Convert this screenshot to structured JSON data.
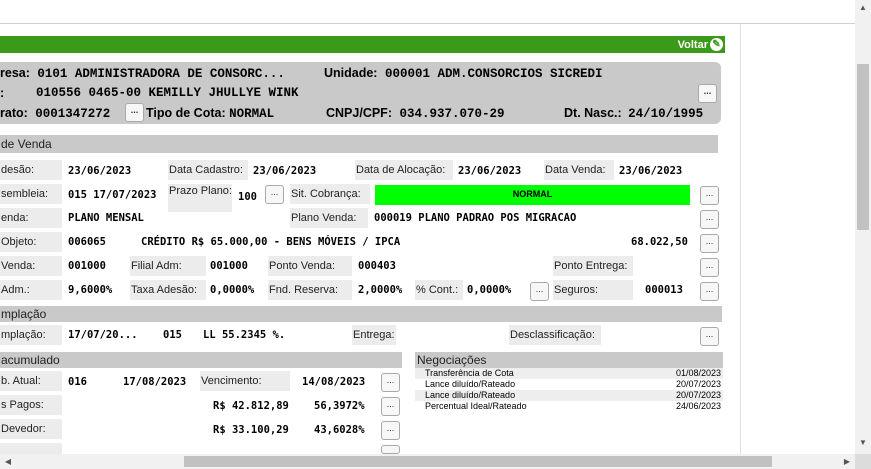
{
  "header": {
    "voltar": "Voltar",
    "empresa_label": "resa:",
    "empresa_value": "0101 ADMINISTRADORA DE CONSORC...",
    "unidade_label": "Unidade:",
    "unidade_value": "000001 ADM.CONSORCIOS SICREDI",
    "row2_label": ":",
    "cliente_value": "010556 0465-00 KEMILLY JHULLYE WINK",
    "contrato_label": "rato:",
    "contrato_value": "0001347272",
    "tipo_cota_label": "Tipo de Cota:",
    "tipo_cota_value": "NORMAL",
    "cnpj_label": "CNPJ/CPF:",
    "cnpj_value": "034.937.070-29",
    "nasc_label": "Dt. Nasc.:",
    "nasc_value": "24/10/1995"
  },
  "sections": {
    "venda": "de Venda",
    "contemplacao": "mplação",
    "acumulado": "acumulado"
  },
  "venda": {
    "adesao_label": "desão:",
    "adesao_value": "23/06/2023",
    "cadastro_label": "Data Cadastro:",
    "cadastro_value": "23/06/2023",
    "alocacao_label": "Data de Alocação:",
    "alocacao_value": "23/06/2023",
    "datavenda_label": "Data Venda:",
    "datavenda_value": "23/06/2023",
    "assembleia_label": "sembleia:",
    "assembleia_value": "015 17/07/2023",
    "prazo_label": "Prazo Plano:",
    "prazo_value": "100",
    "sitcob_label": "Sit. Cobrança:",
    "sitcob_value": "NORMAL",
    "planovenda_label_left": "enda:",
    "plano_value": "PLANO MENSAL",
    "planovenda_label": "Plano Venda:",
    "planovenda_value": "000019 PLANO PADRAO POS MIGRACAO",
    "objeto_label": "Objeto:",
    "objeto_code": "006065",
    "objeto_desc": "CRÉDITO R$ 65.000,00 - BENS MÓVEIS / IPCA",
    "objeto_valor": "68.022,50",
    "pvenda_label": "Venda:",
    "pvenda_value": "001000",
    "filial_label": "Filial Adm:",
    "filial_value": "001000",
    "pontovenda_label": "Ponto Venda:",
    "pontovenda_value": "000403",
    "entrega_label": "Ponto Entrega:",
    "adm_label": "Adm.:",
    "adm_value": "9,6000%",
    "taxa_label": "Taxa Adesão:",
    "taxa_value": "0,0000%",
    "fnd_label": "Fnd. Reserva:",
    "fnd_value": "2,0000%",
    "cont_label": "% Cont.:",
    "cont_value": "0,0000%",
    "seguros_label": "Seguros:",
    "seguros_value": "000013"
  },
  "contemplacao": {
    "label": "mplação:",
    "data": "17/07/20...",
    "num": "015",
    "lance": "LL 55.2345 %.",
    "entrega_label": "Entrega:",
    "desclass_label": "Desclassificação:"
  },
  "acumulado": {
    "atual_label": "b. Atual:",
    "atual_num": "016",
    "atual_data": "17/08/2023",
    "venc_label": "Vencimento:",
    "venc_value": "14/08/2023",
    "pagos_label": "s Pagos:",
    "pagos_valor": "R$ 42.812,89",
    "pagos_pct": "56,3972%",
    "devedor_label": "Devedor:",
    "devedor_valor": "R$ 33.100,29",
    "devedor_pct": "43,6028%"
  },
  "negociacoes": {
    "title": "Negociações",
    "items": [
      {
        "desc": "Transferência de Cota",
        "date": "01/08/2023"
      },
      {
        "desc": "Lance diluído/Rateado",
        "date": "20/07/2023"
      },
      {
        "desc": "Lance diluído/Rateado",
        "date": "20/07/2023"
      },
      {
        "desc": "Percentual Ideal/Rateado",
        "date": "24/06/2023"
      }
    ]
  },
  "buttons": {
    "ellipsis": "..."
  },
  "colors": {
    "green_bar": "#3c9a1a",
    "status_green": "#00ff00",
    "panel_gray": "#c9c9c9"
  }
}
